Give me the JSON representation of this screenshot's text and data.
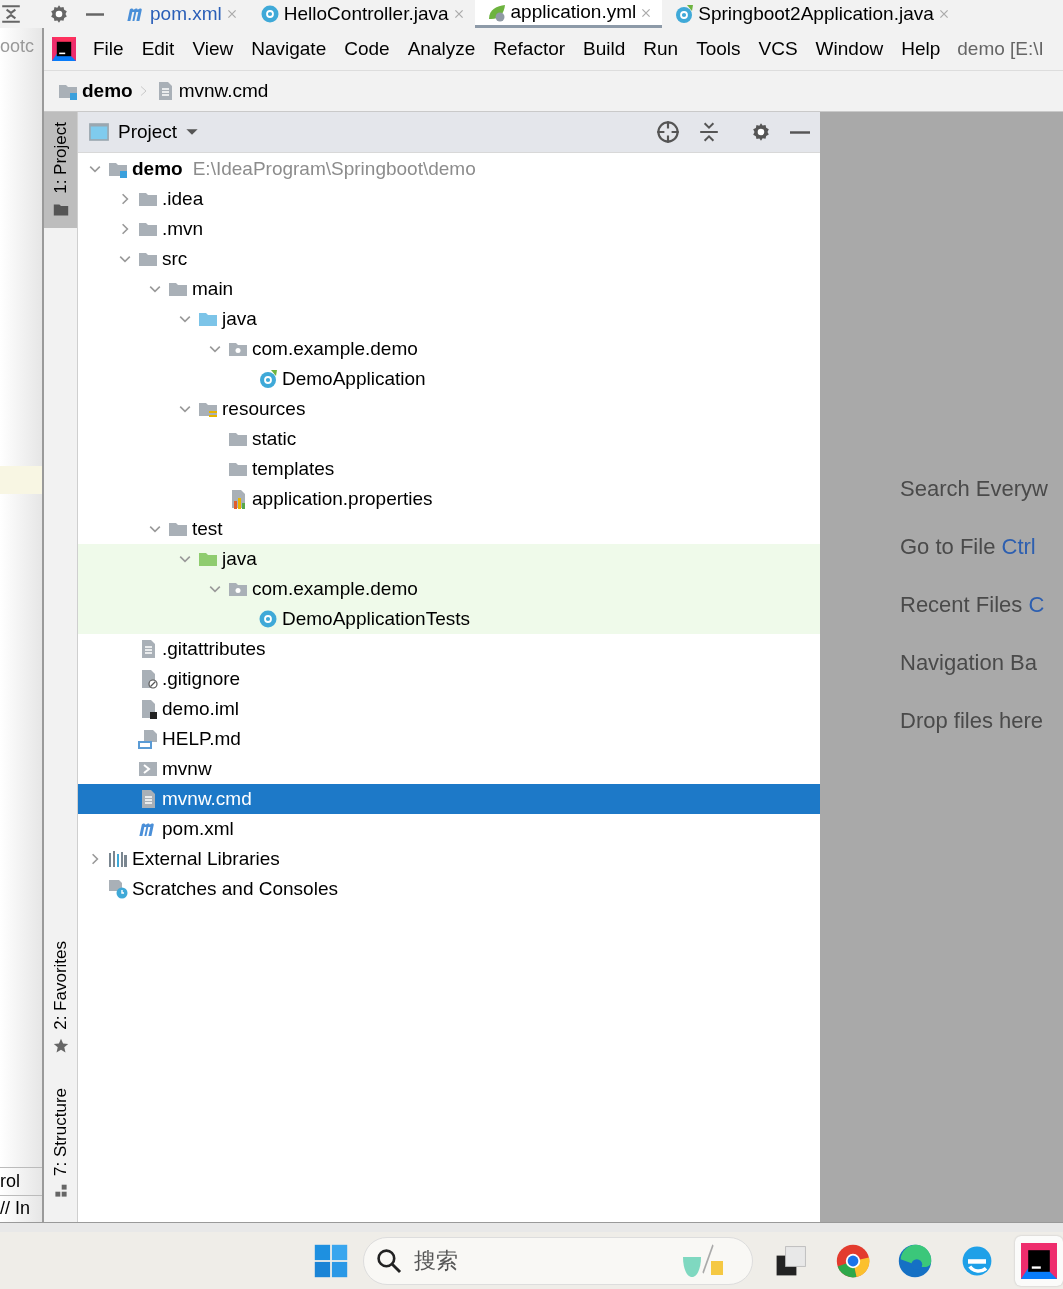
{
  "background_window": {
    "tabs": [
      {
        "label": "pom.xml",
        "kind": "maven",
        "modified": true,
        "selected": false
      },
      {
        "label": "HelloController.java",
        "kind": "class",
        "modified": false,
        "selected": false
      },
      {
        "label": "application.yml",
        "kind": "yaml",
        "modified": false,
        "selected": true
      },
      {
        "label": "Springboot2Application.java",
        "kind": "spring-class",
        "modified": false,
        "selected": false
      }
    ],
    "side_texts": [
      "ootc",
      "rol",
      "// In"
    ]
  },
  "menu": [
    "File",
    "Edit",
    "View",
    "Navigate",
    "Code",
    "Analyze",
    "Refactor",
    "Build",
    "Run",
    "Tools",
    "VCS",
    "Window",
    "Help"
  ],
  "window_title": "demo [E:\\I",
  "breadcrumb": [
    {
      "label": "demo",
      "kind": "module"
    },
    {
      "label": "mvnw.cmd",
      "kind": "text-file"
    }
  ],
  "tool_tabs": [
    {
      "label": "1: Project",
      "kind": "folder",
      "selected": true
    },
    {
      "label": "2: Favorites",
      "kind": "star",
      "selected": false
    },
    {
      "label": "7: Structure",
      "kind": "structure",
      "selected": false
    }
  ],
  "project_panel": {
    "title": "Project",
    "tree": [
      {
        "label": "demo",
        "path": "E:\\IdeaProgram\\Springboot\\demo",
        "kind": "module",
        "expanded": true,
        "selected": false,
        "highlighted": false,
        "children": [
          {
            "label": ".idea",
            "kind": "folder",
            "expanded": false,
            "selected": false,
            "highlighted": false
          },
          {
            "label": ".mvn",
            "kind": "folder",
            "expanded": false,
            "selected": false,
            "highlighted": false
          },
          {
            "label": "src",
            "kind": "folder",
            "expanded": true,
            "selected": false,
            "highlighted": false,
            "children": [
              {
                "label": "main",
                "kind": "folder",
                "expanded": true,
                "selected": false,
                "highlighted": false,
                "children": [
                  {
                    "label": "java",
                    "kind": "source-folder",
                    "expanded": true,
                    "selected": false,
                    "highlighted": false,
                    "children": [
                      {
                        "label": "com.example.demo",
                        "kind": "package",
                        "expanded": true,
                        "selected": false,
                        "highlighted": false,
                        "children": [
                          {
                            "label": "DemoApplication",
                            "kind": "spring-class",
                            "selected": false,
                            "highlighted": false
                          }
                        ]
                      }
                    ]
                  },
                  {
                    "label": "resources",
                    "kind": "resources-folder",
                    "expanded": true,
                    "selected": false,
                    "highlighted": false,
                    "children": [
                      {
                        "label": "static",
                        "kind": "folder",
                        "selected": false,
                        "highlighted": false
                      },
                      {
                        "label": "templates",
                        "kind": "folder",
                        "selected": false,
                        "highlighted": false
                      },
                      {
                        "label": "application.properties",
                        "kind": "properties",
                        "selected": false,
                        "highlighted": false
                      }
                    ]
                  }
                ]
              },
              {
                "label": "test",
                "kind": "folder",
                "expanded": true,
                "selected": false,
                "highlighted": false,
                "children": [
                  {
                    "label": "java",
                    "kind": "test-folder",
                    "expanded": true,
                    "selected": false,
                    "highlighted": true,
                    "children": [
                      {
                        "label": "com.example.demo",
                        "kind": "package",
                        "expanded": true,
                        "selected": false,
                        "highlighted": true,
                        "children": [
                          {
                            "label": "DemoApplicationTests",
                            "kind": "class",
                            "selected": false,
                            "highlighted": true
                          }
                        ]
                      }
                    ]
                  }
                ]
              }
            ]
          },
          {
            "label": ".gitattributes",
            "kind": "text-file",
            "selected": false,
            "highlighted": false
          },
          {
            "label": ".gitignore",
            "kind": "ignore-file",
            "selected": false,
            "highlighted": false
          },
          {
            "label": "demo.iml",
            "kind": "iml",
            "selected": false,
            "highlighted": false
          },
          {
            "label": "HELP.md",
            "kind": "markdown",
            "selected": false,
            "highlighted": false
          },
          {
            "label": "mvnw",
            "kind": "script",
            "selected": false,
            "highlighted": false
          },
          {
            "label": "mvnw.cmd",
            "kind": "text-file",
            "selected": true,
            "highlighted": false
          },
          {
            "label": "pom.xml",
            "kind": "maven",
            "selected": false,
            "highlighted": false
          }
        ]
      },
      {
        "label": "External Libraries",
        "kind": "libraries",
        "expanded": false,
        "selected": false,
        "highlighted": false
      },
      {
        "label": "Scratches and Consoles",
        "kind": "scratches",
        "selected": false,
        "highlighted": false
      }
    ]
  },
  "editor_hints": [
    {
      "label": "Search Everyw"
    },
    {
      "label": "Go to File",
      "shortcut": "Ctrl"
    },
    {
      "label": "Recent Files",
      "shortcut": "C"
    },
    {
      "label": "Navigation Ba"
    },
    {
      "label": "Drop files here"
    }
  ],
  "taskbar": {
    "search_placeholder": "搜索",
    "apps": [
      {
        "kind": "task-view",
        "active": false
      },
      {
        "kind": "chrome",
        "active": false
      },
      {
        "kind": "edge",
        "active": false
      },
      {
        "kind": "ie",
        "active": false
      },
      {
        "kind": "intellij",
        "active": true
      }
    ]
  }
}
